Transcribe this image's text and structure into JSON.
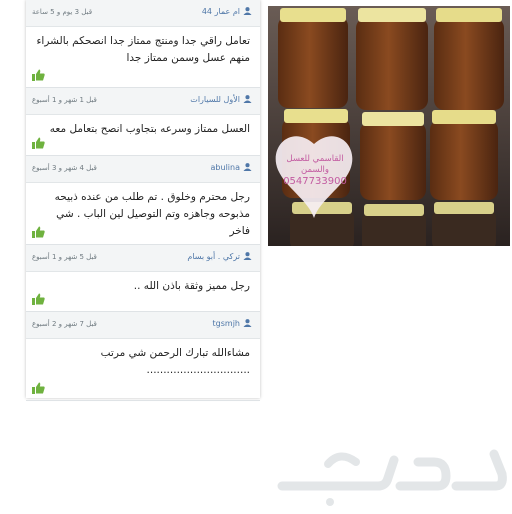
{
  "reviews": [
    {
      "user": "ام عمار 44",
      "time": "قبل 3 يوم و 5 ساعة",
      "text": "تعامل راقي جدا ومنتج ممتاز جدا انصحكم بالشراء منهم عسل وسمن ممتاز جدا"
    },
    {
      "user": "الأول للسيارات",
      "time": "قبل 1 شهر و 1 أسبوع",
      "text": "العسل ممتاز وسرعه بتجاوب انصح بتعامل معه"
    },
    {
      "user": "abulina",
      "time": "قبل 4 شهر و 3 أسبوع",
      "text": "رجل محترم وخلوق . تم طلب من عنده ذبيحه مذبوحه وجاهزه وتم التوصيل لين الباب . شي فاخر"
    },
    {
      "user": "تركي . أبو بسام",
      "time": "قبل 5 شهر و 1 أسبوع",
      "text": "رجل مميز وثقة باذن الله .."
    },
    {
      "user": "tgsmjh",
      "time": "قبل 7 شهر و 2 أسبوع",
      "text": "مشاءالله تبارك الرحمن شي مرتب ..............................."
    }
  ],
  "icons": {
    "user": "person-icon",
    "like": "thumbs-up-icon"
  },
  "photo": {
    "label_line1": "القاسمي للعسل",
    "label_line2": "والسمن",
    "phone": "0547733900"
  },
  "brand": {
    "logo_text": "حراج"
  },
  "colors": {
    "link_blue": "#4f77a8",
    "like_green": "#6fb23f",
    "label_pink": "#c25aa0"
  }
}
